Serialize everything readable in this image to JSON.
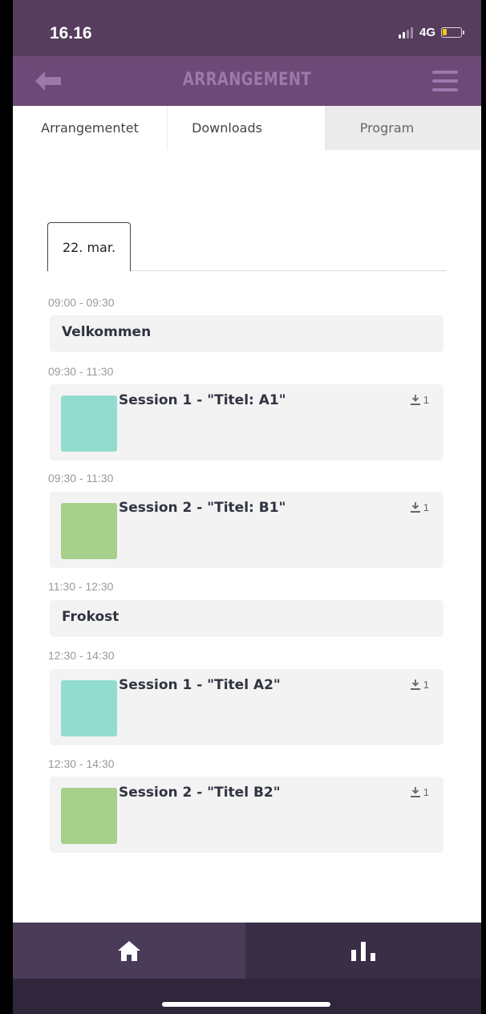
{
  "status_bar": {
    "time": "16.16",
    "network": "4G"
  },
  "header": {
    "title": "ARRANGEMENT"
  },
  "tabs": [
    {
      "label": "Arrangementet"
    },
    {
      "label": "Downloads"
    },
    {
      "label": "Program"
    }
  ],
  "date_tab": {
    "label": "22. mar."
  },
  "schedule": [
    {
      "time": "09:00 - 09:30",
      "title": "Velkommen"
    },
    {
      "time": "09:30 - 11:30",
      "title": "Session 1 - \"Titel: A1\"",
      "downloads": "1",
      "color": "#92dccf"
    },
    {
      "time": "09:30 - 11:30",
      "title": "Session 2 - \"Titel: B1\"",
      "downloads": "1",
      "color": "#a7d08b"
    },
    {
      "time": "11:30 - 12:30",
      "title": "Frokost"
    },
    {
      "time": "12:30 - 14:30",
      "title": "Session 1 - \"Titel A2\"",
      "downloads": "1",
      "color": "#92dccf"
    },
    {
      "time": "12:30 - 14:30",
      "title": "Session 2 - \"Titel B2\"",
      "downloads": "1",
      "color": "#a7d08b"
    }
  ],
  "colors": {
    "status_bar": "#563c5d",
    "header": "#6b4a77",
    "header_accent": "#9c78ac",
    "nav_home": "#4a3b58",
    "nav_stats": "#3a2d46"
  },
  "icons": {
    "back": "arrow-left-icon",
    "menu": "hamburger-menu-icon",
    "download": "download-icon",
    "home": "home-icon",
    "stats": "bar-chart-icon"
  }
}
